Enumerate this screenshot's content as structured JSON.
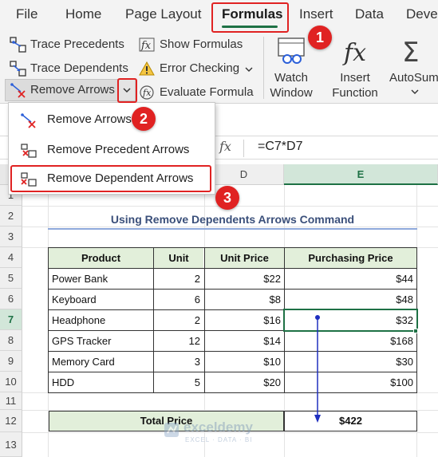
{
  "ribbon_tabs": [
    "File",
    "Home",
    "Page Layout",
    "Formulas",
    "Insert",
    "Data",
    "Devel"
  ],
  "active_tab": "Formulas",
  "formula_auditing": {
    "trace_precedents": "Trace Precedents",
    "trace_dependents": "Trace Dependents",
    "remove_arrows": "Remove Arrows",
    "show_formulas": "Show Formulas",
    "error_checking": "Error Checking",
    "evaluate_formula": "Evaluate Formula"
  },
  "big_buttons": {
    "watch_window_line1": "Watch",
    "watch_window_line2": "Window",
    "insert_function_line1": "Insert",
    "insert_function_line2": "Function",
    "autosum": "AutoSum"
  },
  "dropdown_menu": {
    "items": [
      "Remove Arrows",
      "Remove Precedent Arrows",
      "Remove Dependent Arrows"
    ]
  },
  "formula_bar": {
    "fx_symbol": "fx",
    "formula": "=C7*D7"
  },
  "grid": {
    "visible_columns": [
      "D",
      "E"
    ],
    "active_column": "E",
    "row_numbers": [
      "1",
      "2",
      "3",
      "4",
      "5",
      "6",
      "7",
      "8",
      "9",
      "10",
      "11",
      "12",
      "13"
    ],
    "active_row": "7"
  },
  "sheet": {
    "title": "Using Remove Dependents Arrows Command",
    "headers": [
      "Product",
      "Unit",
      "Unit Price",
      "Purchasing Price"
    ],
    "rows": [
      [
        "Power Bank",
        "2",
        "$22",
        "$44"
      ],
      [
        "Keyboard",
        "6",
        "$8",
        "$48"
      ],
      [
        "Headphone",
        "2",
        "$16",
        "$32"
      ],
      [
        "GPS Tracker",
        "12",
        "$14",
        "$168"
      ],
      [
        "Memory Card",
        "3",
        "$10",
        "$30"
      ],
      [
        "HDD",
        "5",
        "$20",
        "$100"
      ]
    ],
    "total_label": "Total Price",
    "total_value": "$422"
  },
  "step_badges": [
    "1",
    "2",
    "3"
  ],
  "watermark": {
    "brand": "exceldemy",
    "tagline": "EXCEL · DATA · BI"
  },
  "colors": {
    "accent_green": "#1e7145",
    "header_fill": "#e2efda",
    "annotation_red": "#e02222",
    "trace_arrow_blue": "#1f2fbf"
  }
}
